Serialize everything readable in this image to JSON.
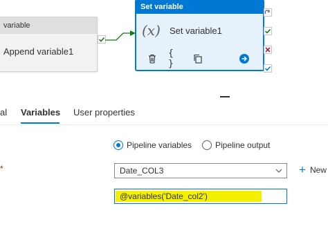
{
  "pipeline": {
    "activity_append": {
      "header": "variable",
      "title": "Append variable1"
    },
    "activity_set": {
      "header": "Set variable",
      "icon_text": "(x)",
      "title": "Set variable1"
    },
    "colors": {
      "accent": "#0078d4",
      "success": "#107c10",
      "error": "#a4262c",
      "highlight": "#f4f100"
    }
  },
  "tabs": [
    {
      "label": "al"
    },
    {
      "label": "Variables"
    },
    {
      "label": "User properties"
    }
  ],
  "variable_type": {
    "options": [
      {
        "label": "Pipeline variables",
        "checked": true
      },
      {
        "label": "Pipeline output",
        "checked": false
      }
    ]
  },
  "form": {
    "required_marker": "*",
    "name_select_value": "Date_COL3",
    "new_label": "New",
    "value_text": "@variables('Date_col2')"
  },
  "icons": [
    "delete-icon",
    "braces-icon",
    "copy-icon",
    "arrow-right-icon",
    "completion-icon",
    "success-check-icon",
    "failure-x-icon",
    "skip-check-icon",
    "chevron-down-icon",
    "plus-icon"
  ]
}
